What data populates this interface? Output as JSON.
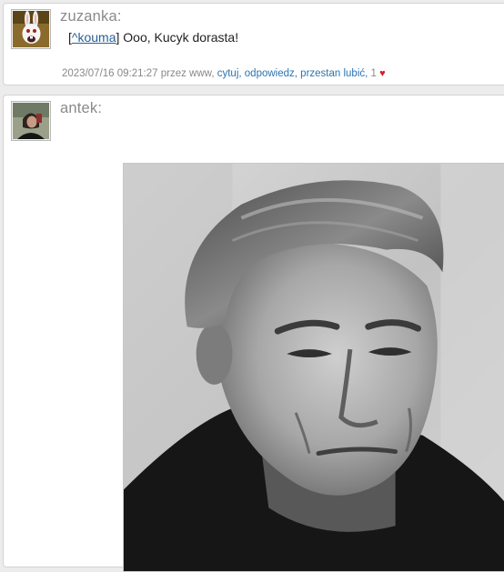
{
  "posts": [
    {
      "username": "zuzanka:",
      "quote_link": "^kouma",
      "quote_open": "[",
      "quote_close": "]",
      "text": " Ooo, Kucyk dorasta!",
      "meta": {
        "timestamp": "2023/07/16 09:21:27",
        "by_text": "przez www,",
        "action_quote": "cytuj,",
        "action_reply": "odpowiedz,",
        "action_unlike": "przestan lubić,",
        "likes": "1"
      }
    },
    {
      "username": "antek:"
    }
  ],
  "colors": {
    "link": "#2a74b3",
    "heart": "#d6202c",
    "username": "#8a8a8a"
  },
  "icons": {
    "like": "heart-icon"
  }
}
